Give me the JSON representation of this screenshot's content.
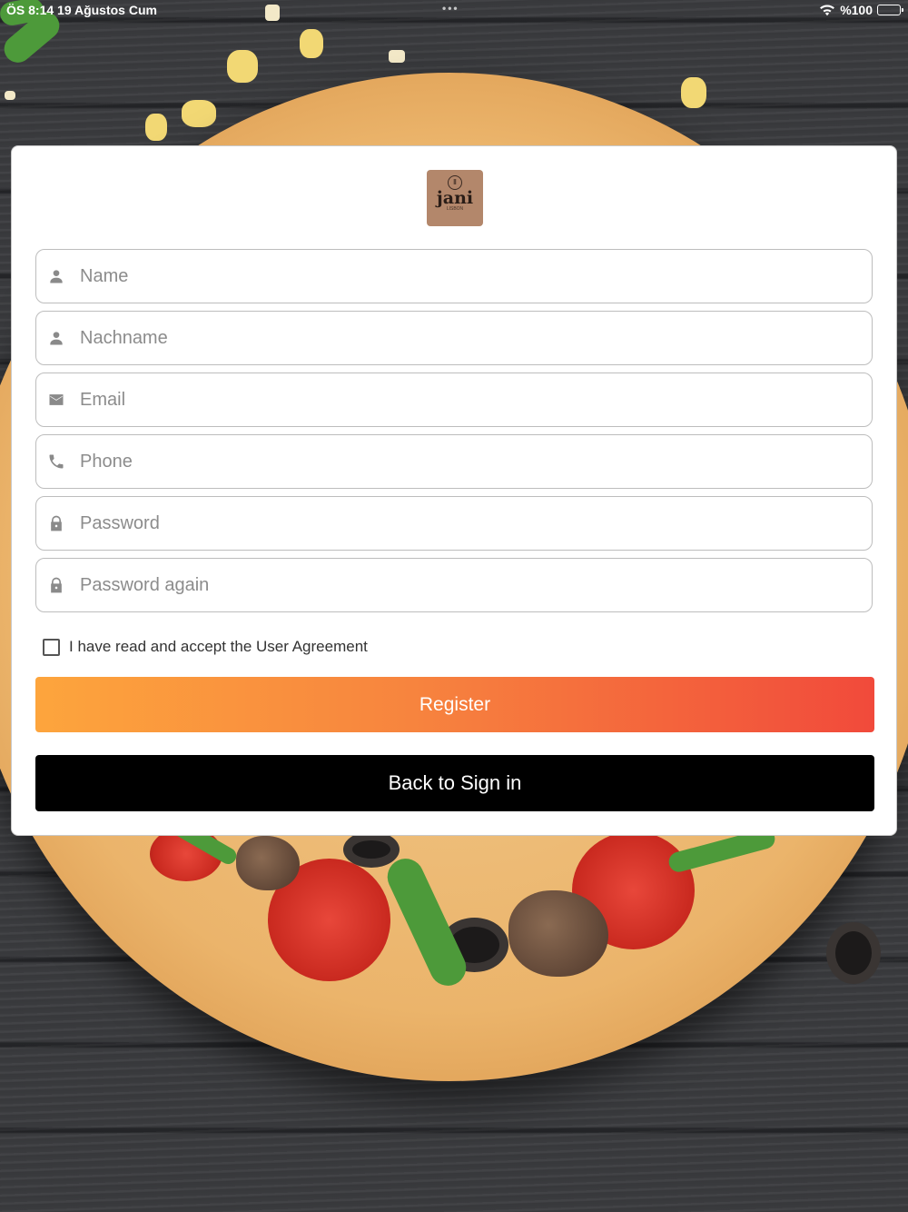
{
  "status_bar": {
    "time_date": "ÖS 8:14   19 Ağustos Cum",
    "multitask_dots": "•••",
    "battery_text": "%100",
    "icons": [
      "wifi-icon",
      "battery-icon"
    ]
  },
  "logo": {
    "word": "jani",
    "sub": "LISBON"
  },
  "form": {
    "fields": [
      {
        "placeholder": "Name",
        "icon": "person-icon",
        "value": ""
      },
      {
        "placeholder": "Nachname",
        "icon": "person-icon",
        "value": ""
      },
      {
        "placeholder": "Email",
        "icon": "mail-icon",
        "value": ""
      },
      {
        "placeholder": "Phone",
        "icon": "phone-icon",
        "value": ""
      },
      {
        "placeholder": "Password",
        "icon": "lock-icon",
        "value": ""
      },
      {
        "placeholder": "Password again",
        "icon": "lock-icon",
        "value": ""
      }
    ],
    "agreement_label": "I have read and accept the User Agreement",
    "agreement_checked": false,
    "register_label": "Register",
    "back_label": "Back to Sign in"
  },
  "colors": {
    "register_gradient_start": "#fda53d",
    "register_gradient_end": "#f14a3b",
    "back_button": "#000000",
    "logo_bg": "#b3876b"
  }
}
